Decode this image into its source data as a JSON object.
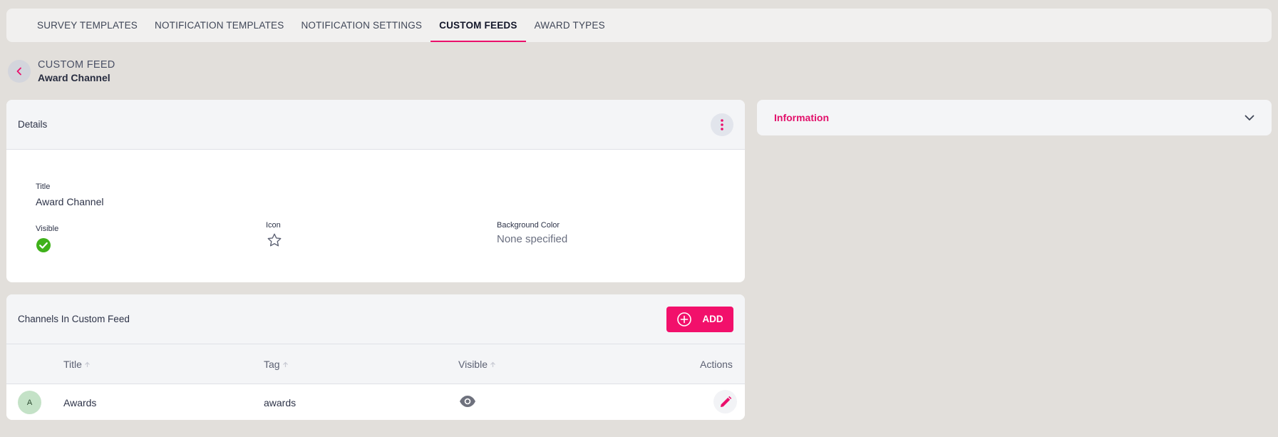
{
  "topnav": {
    "tabs": [
      {
        "label": "SURVEY TEMPLATES",
        "active": false
      },
      {
        "label": "NOTIFICATION TEMPLATES",
        "active": false
      },
      {
        "label": "NOTIFICATION SETTINGS",
        "active": false
      },
      {
        "label": "CUSTOM FEEDS",
        "active": true
      },
      {
        "label": "AWARD TYPES",
        "active": false
      }
    ]
  },
  "header": {
    "kicker": "CUSTOM FEED",
    "title": "Award Channel"
  },
  "details": {
    "heading": "Details",
    "title_label": "Title",
    "title_value": "Award Channel",
    "visible_label": "Visible",
    "visible_value": true,
    "icon_label": "Icon",
    "icon_value": "star-outline-icon",
    "bg_label": "Background Color",
    "bg_value": "None specified"
  },
  "information": {
    "title": "Information"
  },
  "channels": {
    "heading": "Channels In Custom Feed",
    "add_label": "ADD",
    "columns": {
      "title": "Title",
      "tag": "Tag",
      "visible": "Visible",
      "actions": "Actions"
    },
    "rows": [
      {
        "avatar": "A",
        "title": "Awards",
        "tag": "awards",
        "visible": true
      }
    ]
  },
  "colors": {
    "accent": "#ea0f6b",
    "background": "#e2dfdb",
    "visible_check": "#3fb11a"
  }
}
